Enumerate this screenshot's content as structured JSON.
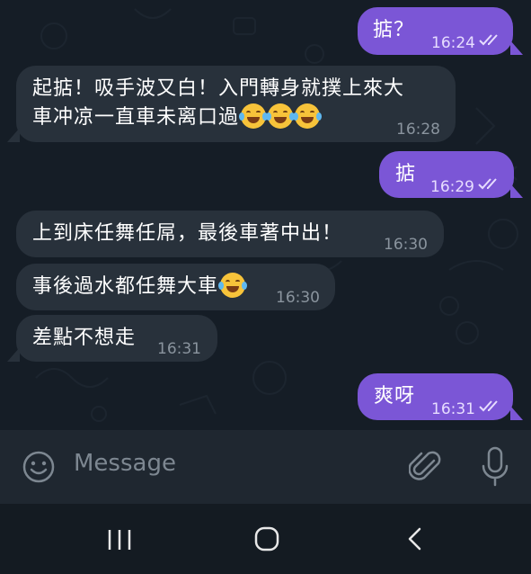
{
  "composer": {
    "placeholder": "Message"
  },
  "messages": [
    {
      "dir": "out",
      "text": "掂？",
      "time": "16:24",
      "read": true
    },
    {
      "dir": "in",
      "line1": "起掂！吸手波又白！入門轉身就撲上來大",
      "line2": "車冲凉一直車未离口過",
      "emoji_count": 3,
      "emoji": "face-with-tears-of-joy",
      "time": "16:28"
    },
    {
      "dir": "out",
      "text": "掂",
      "time": "16:29",
      "read": true
    },
    {
      "dir": "in",
      "text": "上到床任舞任屌，最後車著中出！",
      "time": "16:30"
    },
    {
      "dir": "in",
      "text": "事後過水都任舞大車",
      "emoji_count": 1,
      "emoji": "face-with-tears-of-joy",
      "time": "16:30"
    },
    {
      "dir": "in",
      "text": "差點不想走",
      "time": "16:31"
    },
    {
      "dir": "out",
      "text": "爽呀",
      "time": "16:31",
      "read": true
    }
  ],
  "colors": {
    "outgoing_bubble": "#7b56d6",
    "incoming_bubble": "#28313b",
    "background": "#151d26"
  },
  "icons": {
    "emoji": "smiley-icon",
    "attach": "paperclip-icon",
    "mic": "microphone-icon",
    "nav_recents": "recents-icon",
    "nav_home": "home-icon",
    "nav_back": "back-icon"
  }
}
